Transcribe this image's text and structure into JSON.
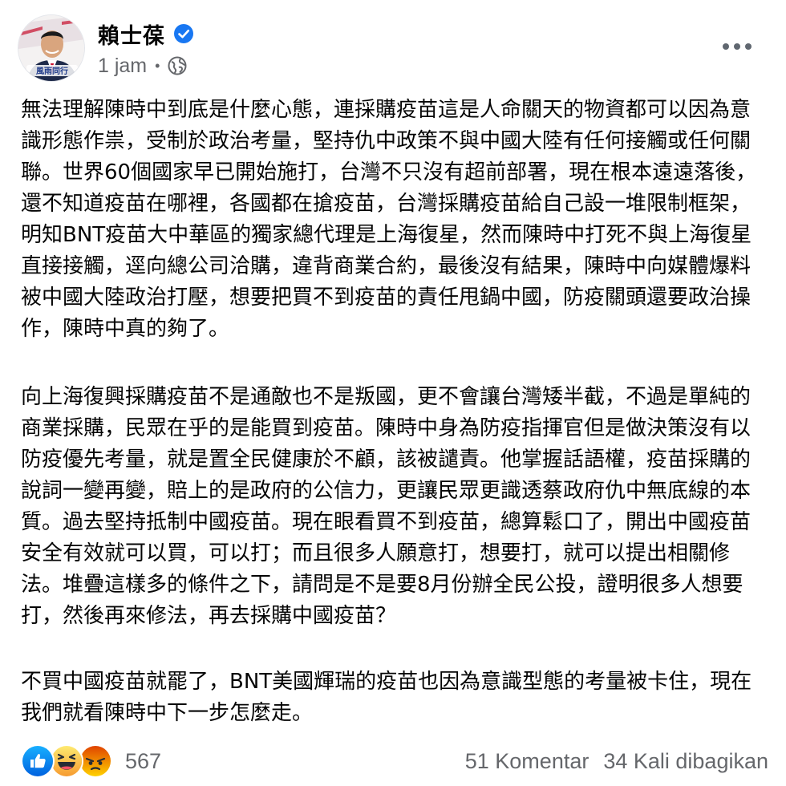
{
  "post": {
    "author": {
      "name": "賴士葆",
      "verified": true,
      "avatar_text": "風雨同行"
    },
    "meta": {
      "time": "1 jam",
      "audience_icon": "globe-icon"
    },
    "more_icon": "more-horizontal-icon",
    "paragraphs": [
      "無法理解陳時中到底是什麼心態，連採購疫苗這是人命關天的物資都可以因為意識形態作祟，受制於政治考量，堅持仇中政策不與中國大陸有任何接觸或任何關聯。世界60個國家早已開始施打，台灣不只沒有超前部署，現在根本遠遠落後，還不知道疫苗在哪裡，各國都在搶疫苗，台灣採購疫苗給自己設一堆限制框架，明知BNT疫苗大中華區的獨家總代理是上海復星，然而陳時中打死不與上海復星直接接觸，逕向總公司洽購，違背商業合約，最後沒有結果，陳時中向媒體爆料被中國大陸政治打壓，想要把買不到疫苗的責任甩鍋中國，防疫關頭還要政治操作，陳時中真的夠了。",
      "向上海復興採購疫苗不是通敵也不是叛國，更不會讓台灣矮半截，不過是單純的商業採購，民眾在乎的是能買到疫苗。陳時中身為防疫指揮官但是做決策沒有以防疫優先考量，就是置全民健康於不顧，該被譴責。他掌握話語權，疫苗採購的說詞一變再變，賠上的是政府的公信力，更讓民眾更識透蔡政府仇中無底線的本質。過去堅持抵制中國疫苗。現在眼看買不到疫苗，總算鬆口了，開出中國疫苗安全有效就可以買，可以打；而且很多人願意打，想要打，就可以提出相關修法。堆疊這樣多的條件之下，請問是不是要8月份辦全民公投，證明很多人想要打，然後再來修法，再去採購中國疫苗？",
      "不買中國疫苗就罷了，BNT美國輝瑞的疫苗也因為意識型態的考量被卡住，現在我們就看陳時中下一步怎麼走。"
    ],
    "footer": {
      "reaction_icons": [
        "like-icon",
        "haha-icon",
        "angry-icon"
      ],
      "reaction_count": "567",
      "comments": "51 Komentar",
      "shares": "34 Kali dibagikan"
    }
  },
  "colors": {
    "text": "#050505",
    "secondary": "#65676b",
    "verified": "#1877f2",
    "like": "#1877f2",
    "haha": "#f7b928",
    "angry": "#e9710f"
  }
}
